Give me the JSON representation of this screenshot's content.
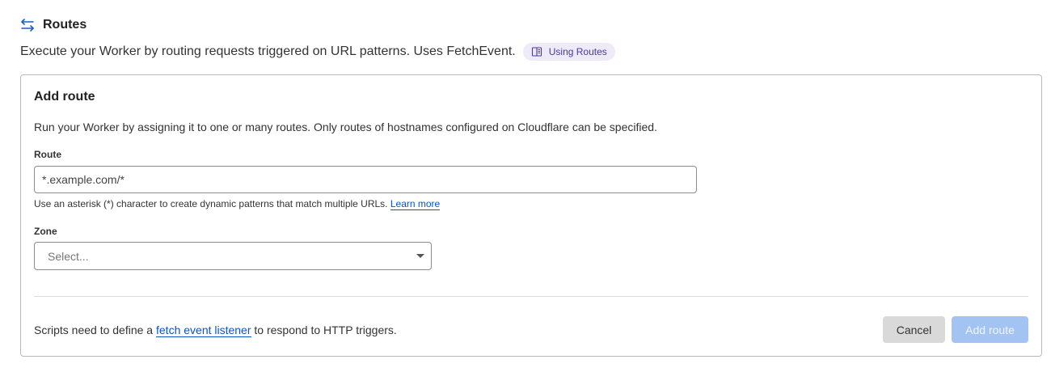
{
  "section": {
    "icon": "swap-arrows-icon",
    "title": "Routes",
    "description": "Execute your Worker by routing requests triggered on URL patterns. Uses FetchEvent.",
    "doc_link": {
      "icon": "book-icon",
      "label": "Using Routes"
    }
  },
  "card": {
    "title": "Add route",
    "description": "Run your Worker by assigning it to one or many routes. Only routes of hostnames configured on Cloudflare can be specified.",
    "route": {
      "label": "Route",
      "placeholder": "*.example.com/*",
      "value": "",
      "helper": "Use an asterisk (*) character to create dynamic patterns that match multiple URLs.",
      "helper_link": "Learn more"
    },
    "zone": {
      "label": "Zone",
      "placeholder": "Select..."
    },
    "footer": {
      "prefix": "Scripts need to define a ",
      "link": "fetch event listener",
      "suffix": " to respond to HTTP triggers."
    },
    "buttons": {
      "cancel": "Cancel",
      "add": "Add route"
    }
  },
  "colors": {
    "accent": "#0a55c0",
    "pill_bg": "#eeeaf8",
    "add_disabled": "#a3c4f3"
  }
}
